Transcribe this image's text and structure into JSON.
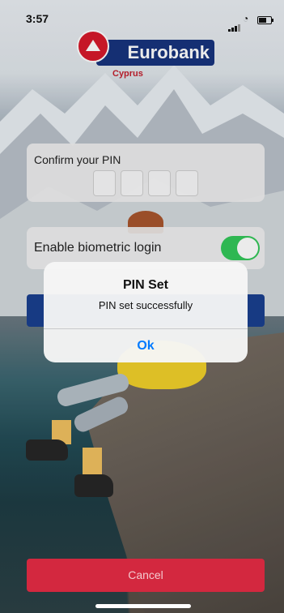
{
  "status_bar": {
    "time": "3:57"
  },
  "brand": {
    "name": "Eurobank",
    "region": "Cyprus"
  },
  "pin_card": {
    "label": "Confirm your PIN",
    "digits": [
      "",
      "",
      "",
      ""
    ]
  },
  "biometric": {
    "label": "Enable biometric login",
    "enabled": true
  },
  "alert": {
    "title": "PIN Set",
    "message": "PIN set successfully",
    "ok_label": "Ok"
  },
  "cancel_label": "Cancel",
  "colors": {
    "brand_blue": "#17347d",
    "brand_red": "#d61a2b",
    "toggle_on": "#34c759",
    "cancel": "#d3283f",
    "ios_blue": "#007aff"
  }
}
